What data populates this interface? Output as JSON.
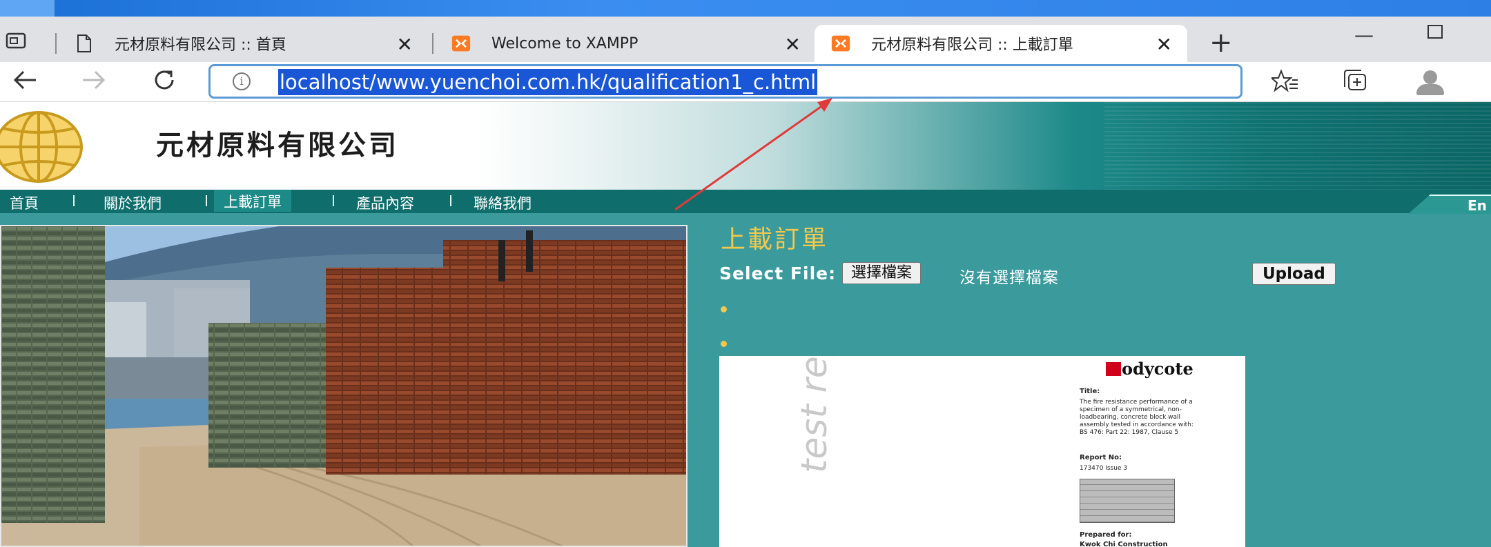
{
  "browser": {
    "tabs": [
      {
        "title": "元材原料有限公司 :: 首頁",
        "icon": "page-icon"
      },
      {
        "title": "Welcome to XAMPP",
        "icon": "xampp-icon"
      },
      {
        "title": "元材原料有限公司 :: 上載訂單",
        "icon": "xampp-icon",
        "active": true
      }
    ],
    "close_glyph": "✕",
    "new_tab_glyph": "+",
    "minimize_glyph": "—",
    "url": "localhost/www.yuenchoi.com.hk/qualification1_c.html",
    "info_glyph": "i"
  },
  "site": {
    "title": "元材原料有限公司",
    "menu": [
      "首頁",
      "關於我們",
      "上載訂單",
      "產品內容",
      "聯絡我們"
    ],
    "menu_separator": "|",
    "current_menu_index": 2,
    "language_tab": "En"
  },
  "content": {
    "section_title": "上載訂單",
    "select_file_label": "Select File:",
    "choose_file_button": "選擇檔案",
    "no_file_text": "沒有選擇檔案",
    "upload_button": "Upload",
    "document": {
      "side_text": "test report",
      "brand": "odycote",
      "title_label": "Title:",
      "title_text": "The fire resistance performance of a specimen of a symmetrical, non-loadbearing, concrete block wall assembly tested in accordance with: BS 476: Part 22: 1987, Clause 5",
      "report_no_label": "Report No:",
      "report_no": "173470 Issue 3",
      "prepared_for_label": "Prepared for:",
      "prepared_for": "Kwok Chi Construction"
    }
  },
  "colors": {
    "page_bg": "#3a9a9c",
    "menu_bg": "#0f6e6c",
    "accent_yellow": "#f2c94c",
    "url_highlight": "#1a57d6",
    "arrow_red": "#e03a3a"
  }
}
